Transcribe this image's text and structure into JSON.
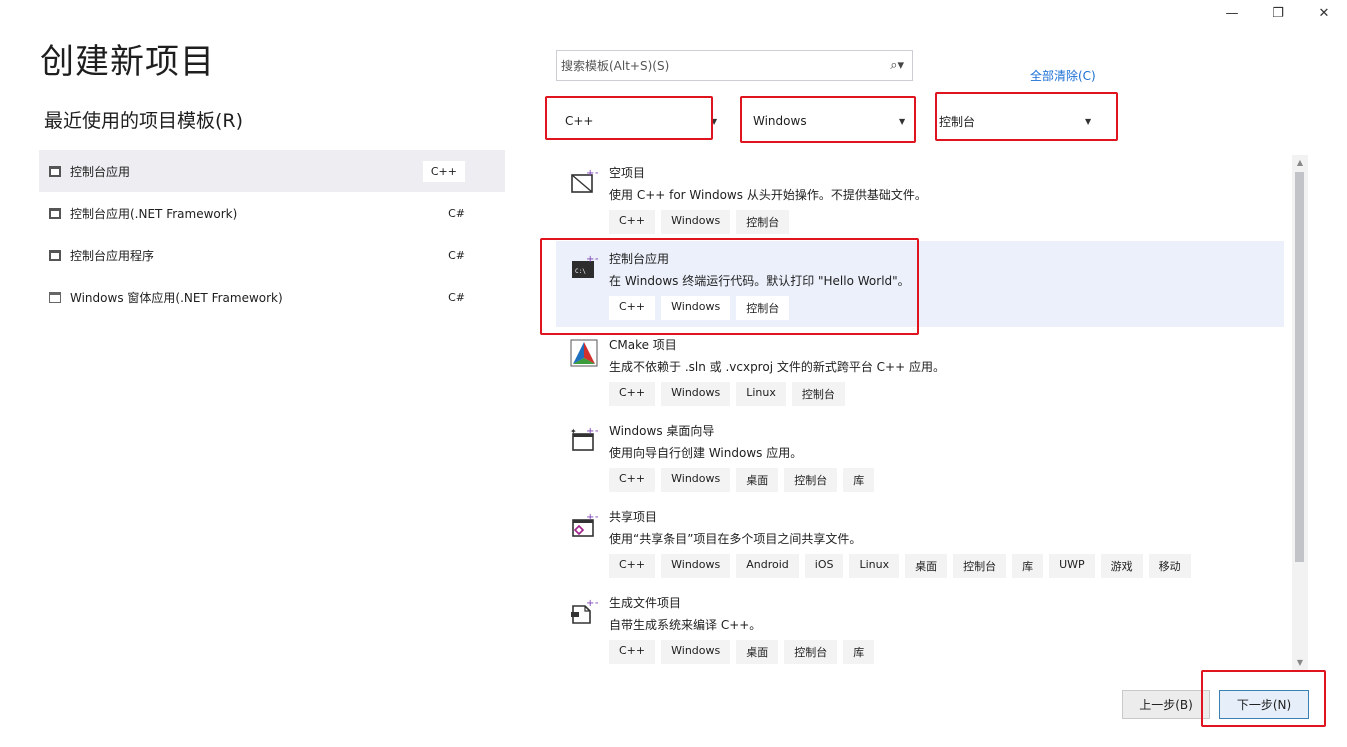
{
  "window": {
    "minimize_glyph": "—",
    "restore_glyph": "❐",
    "close_glyph": "✕"
  },
  "page_title": "创建新项目",
  "recent": {
    "title": "最近使用的项目模板(R)",
    "items": [
      {
        "name": "控制台应用",
        "lang": "C++",
        "icon": "console-app-icon"
      },
      {
        "name": "控制台应用(.NET Framework)",
        "lang": "C#",
        "icon": "console-app-icon"
      },
      {
        "name": "控制台应用程序",
        "lang": "C#",
        "icon": "console-app-icon"
      },
      {
        "name": "Windows 窗体应用(.NET Framework)",
        "lang": "C#",
        "icon": "winforms-icon"
      }
    ]
  },
  "search": {
    "placeholder": "搜索模板(Alt+S)(S)"
  },
  "clear_all": "全部清除(C)",
  "filters": {
    "language": "C++",
    "platform": "Windows",
    "project_type": "控制台"
  },
  "templates": [
    {
      "name": "空项目",
      "description": "使用 C++ for Windows 从头开始操作。不提供基础文件。",
      "tags": [
        "C++",
        "Windows",
        "控制台"
      ],
      "icon": "empty-project-icon"
    },
    {
      "name": "控制台应用",
      "description": "在 Windows 终端运行代码。默认打印 \"Hello World\"。",
      "tags": [
        "C++",
        "Windows",
        "控制台"
      ],
      "icon": "console-app-icon"
    },
    {
      "name": "CMake 项目",
      "description": "生成不依赖于 .sln 或 .vcxproj 文件的新式跨平台 C++ 应用。",
      "tags": [
        "C++",
        "Windows",
        "Linux",
        "控制台"
      ],
      "icon": "cmake-icon"
    },
    {
      "name": "Windows 桌面向导",
      "description": "使用向导自行创建 Windows 应用。",
      "tags": [
        "C++",
        "Windows",
        "桌面",
        "控制台",
        "库"
      ],
      "icon": "desktop-wizard-icon"
    },
    {
      "name": "共享项目",
      "description": "使用“共享条目”项目在多个项目之间共享文件。",
      "tags": [
        "C++",
        "Windows",
        "Android",
        "iOS",
        "Linux",
        "桌面",
        "控制台",
        "库",
        "UWP",
        "游戏",
        "移动"
      ],
      "icon": "shared-project-icon"
    },
    {
      "name": "生成文件项目",
      "description": "自带生成系统来编译 C++。",
      "tags": [
        "C++",
        "Windows",
        "桌面",
        "控制台",
        "库"
      ],
      "icon": "makefile-project-icon"
    }
  ],
  "buttons": {
    "back": "上一步(B)",
    "next": "下一步(N)"
  }
}
